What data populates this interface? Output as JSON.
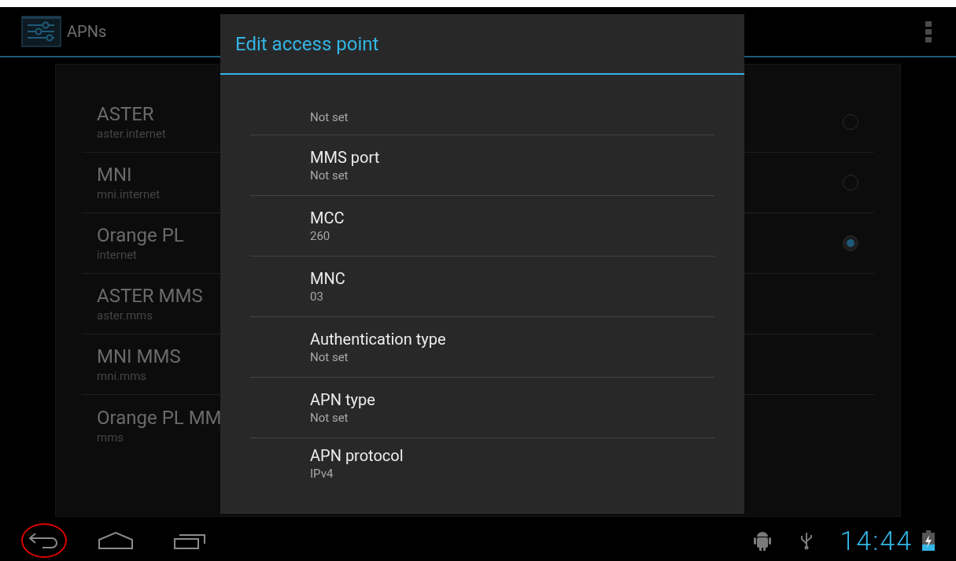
{
  "action_bar": {
    "title": "APNs"
  },
  "apn_list": [
    {
      "name": "ASTER",
      "apn": "aster.internet",
      "kind": "radio",
      "selected": false
    },
    {
      "name": "MNI",
      "apn": "mni.internet",
      "kind": "radio",
      "selected": false
    },
    {
      "name": "Orange PL",
      "apn": "internet",
      "kind": "radio",
      "selected": true
    },
    {
      "name": "ASTER MMS",
      "apn": "aster.mms",
      "kind": "plain"
    },
    {
      "name": "MNI MMS",
      "apn": "mni.mms",
      "kind": "plain"
    },
    {
      "name": "Orange PL MM",
      "apn": "mms",
      "kind": "plain"
    }
  ],
  "dialog": {
    "title": "Edit access point",
    "fields": [
      {
        "value": "Not set"
      },
      {
        "label": "MMS port",
        "value": "Not set"
      },
      {
        "label": "MCC",
        "value": "260"
      },
      {
        "label": "MNC",
        "value": "03"
      },
      {
        "label": "Authentication type",
        "value": "Not set"
      },
      {
        "label": "APN type",
        "value": "Not set"
      },
      {
        "label": "APN protocol",
        "value": "IPv4"
      }
    ]
  },
  "status_bar": {
    "time": "14:44"
  }
}
